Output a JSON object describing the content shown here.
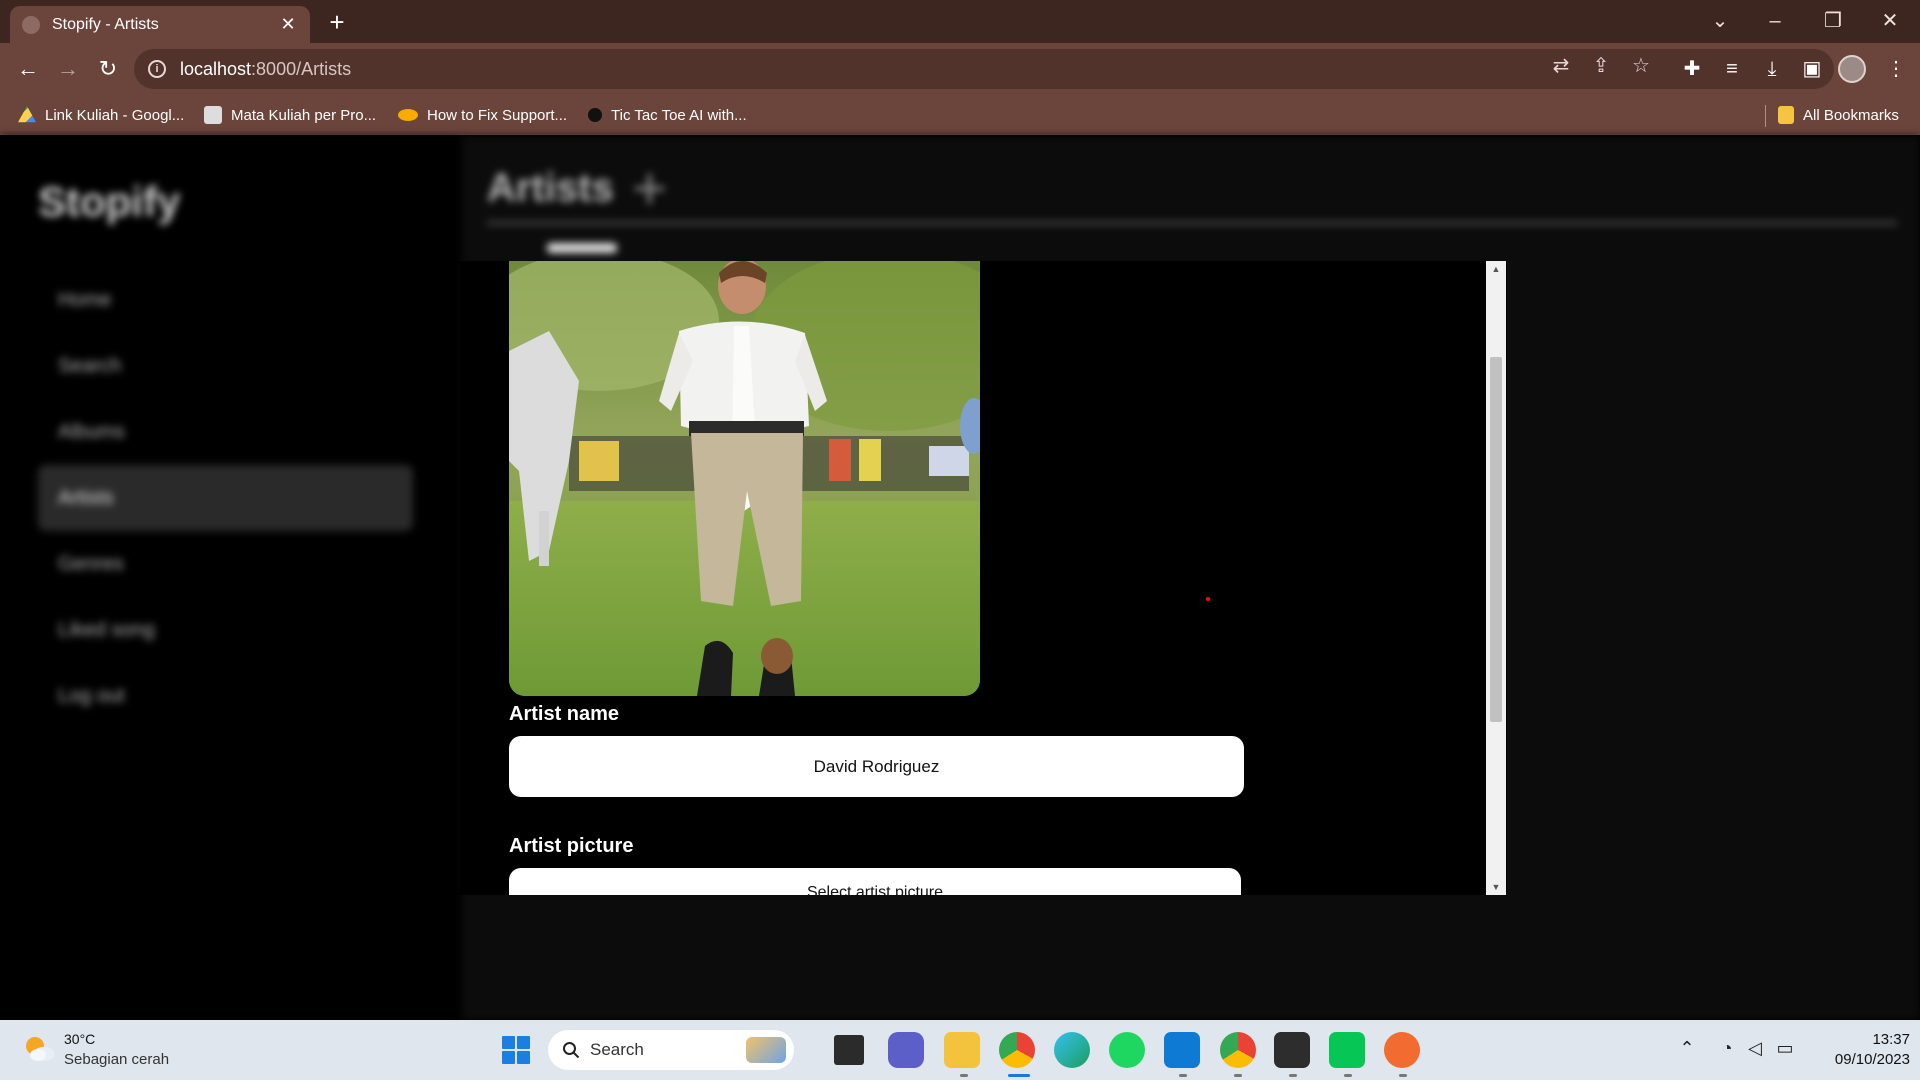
{
  "browser": {
    "tab_title": "Stopify - Artists",
    "url_host": "localhost",
    "url_path": ":8000/Artists",
    "new_tab_symbol": "+",
    "bookmarks": [
      {
        "label": "Link Kuliah - Googl...",
        "icon": "google-drive-icon"
      },
      {
        "label": "Mata Kuliah per Pro...",
        "icon": "site-icon"
      },
      {
        "label": "How to Fix Support...",
        "icon": "colab-icon"
      },
      {
        "label": "Tic Tac Toe AI with...",
        "icon": "site-icon"
      }
    ],
    "all_bookmarks_label": "All Bookmarks"
  },
  "app": {
    "brand": "Stopify",
    "nav": [
      "Home",
      "Search",
      "Albums",
      "Artists",
      "Genres",
      "Liked song",
      "Log out"
    ],
    "active_nav": "Artists",
    "page_title": "Artists",
    "add_symbol": "+"
  },
  "modal": {
    "artist_name_label": "Artist name",
    "artist_name_value": "David Rodriguez",
    "artist_picture_label": "Artist picture",
    "picture_button_label": "Select artist picture"
  },
  "taskbar": {
    "weather_temp": "30°C",
    "weather_desc": "Sebagian cerah",
    "search_placeholder": "Search",
    "time": "13:37",
    "date": "09/10/2023"
  },
  "colors": {
    "titlebar": "#3d2520",
    "toolbar": "#6b453b",
    "modal_bg": "#000000",
    "input_bg": "#ffffff"
  }
}
